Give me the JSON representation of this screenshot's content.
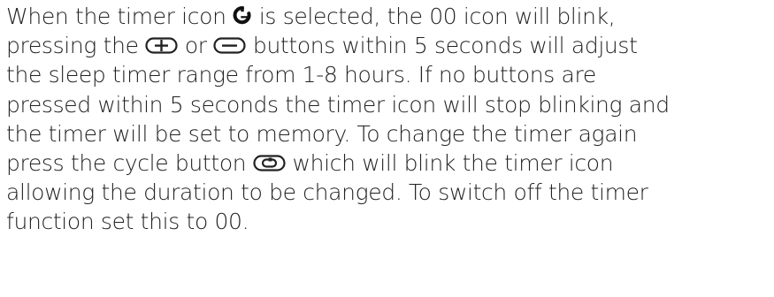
{
  "instruction": {
    "line1": {
      "before": "When the timer icon",
      "after": "is selected, the 00 icon will blink,"
    },
    "line2": {
      "before": "pressing the",
      "middle": "or",
      "after": "buttons within 5 seconds will adjust"
    },
    "line3": "the sleep timer range from 1-8 hours. If no buttons are",
    "line4": "pressed within 5 seconds the timer icon will stop blinking and",
    "line5": "the timer will be set to memory. To change the timer again",
    "line6": {
      "before": "press the cycle button",
      "after": "which will blink the timer icon"
    },
    "line7": "allowing the duration to be changed. To switch off the timer",
    "line8": "function set this to 00."
  },
  "icons": {
    "timer": "timer-icon",
    "plus": "plus-button-icon",
    "minus": "minus-button-icon",
    "cycle": "cycle-button-icon"
  }
}
